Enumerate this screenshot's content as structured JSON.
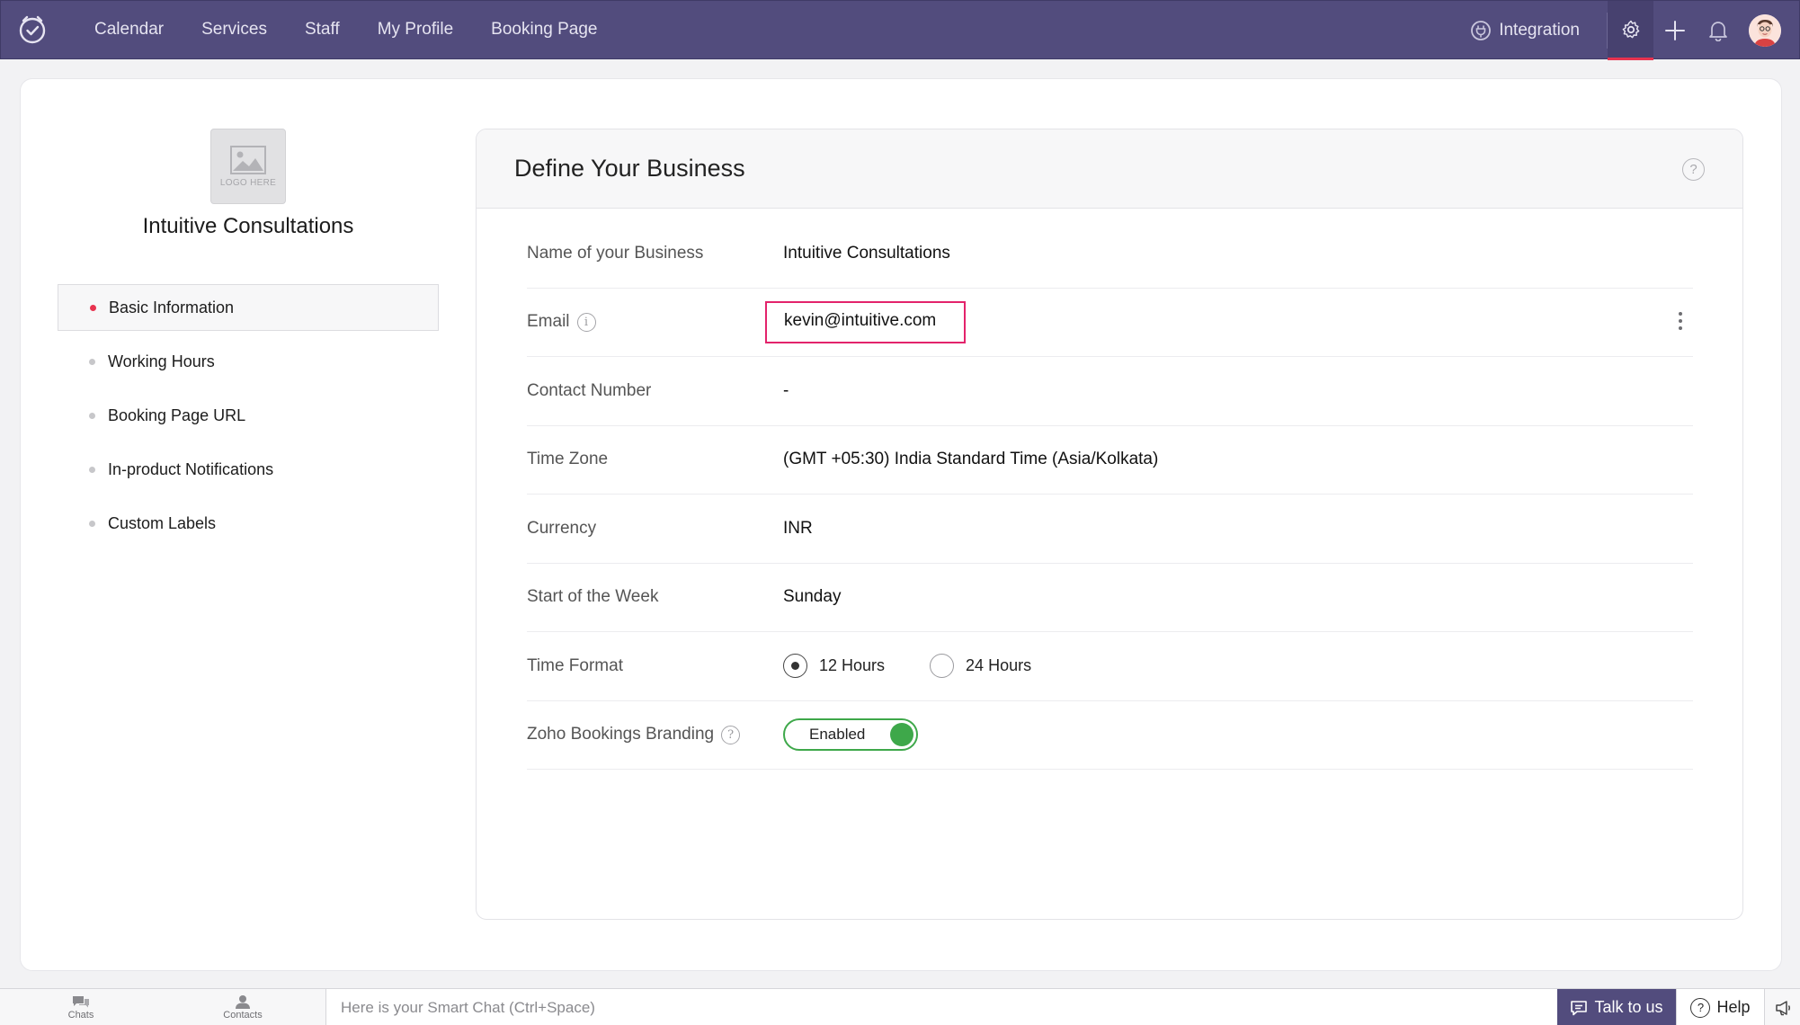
{
  "nav": {
    "items": [
      {
        "label": "Calendar"
      },
      {
        "label": "Services"
      },
      {
        "label": "Staff"
      },
      {
        "label": "My Profile"
      },
      {
        "label": "Booking Page"
      }
    ],
    "integration_label": "Integration",
    "icons": [
      "app-logo-icon",
      "integration-icon",
      "gear-icon",
      "plus-icon",
      "bell-icon",
      "avatar"
    ],
    "accent_color": "#e8334f",
    "bar_color": "#524c7d"
  },
  "sidebar": {
    "logo_placeholder": "LOGO HERE",
    "business_name": "Intuitive Consultations",
    "items": [
      {
        "label": "Basic Information",
        "active": true
      },
      {
        "label": "Working Hours"
      },
      {
        "label": "Booking Page URL"
      },
      {
        "label": "In-product Notifications"
      },
      {
        "label": "Custom Labels"
      }
    ]
  },
  "panel": {
    "title": "Define Your Business",
    "help_icon": "?",
    "rows": {
      "name": {
        "label": "Name of your Business",
        "value": "Intuitive Consultations"
      },
      "email": {
        "label": "Email",
        "value": "kevin@intuitive.com",
        "info_icon": "i"
      },
      "contact": {
        "label": "Contact Number",
        "value": "-"
      },
      "timezone": {
        "label": "Time Zone",
        "value": "(GMT +05:30) India Standard Time (Asia/Kolkata)"
      },
      "currency": {
        "label": "Currency",
        "value": "INR"
      },
      "week_start": {
        "label": "Start of the Week",
        "value": "Sunday"
      },
      "time_format": {
        "label": "Time Format",
        "options": [
          "12 Hours",
          "24 Hours"
        ],
        "selected": "12 Hours"
      },
      "branding": {
        "label": "Zoho Bookings Branding",
        "value": "Enabled",
        "help_icon": "?"
      }
    },
    "highlight_color": "#e3236b",
    "toggle_color": "#3ea84a"
  },
  "bottombar": {
    "chats_label": "Chats",
    "contacts_label": "Contacts",
    "smart_chat_placeholder": "Here is your Smart Chat (Ctrl+Space)",
    "talk_label": "Talk to us",
    "help_label": "Help"
  }
}
